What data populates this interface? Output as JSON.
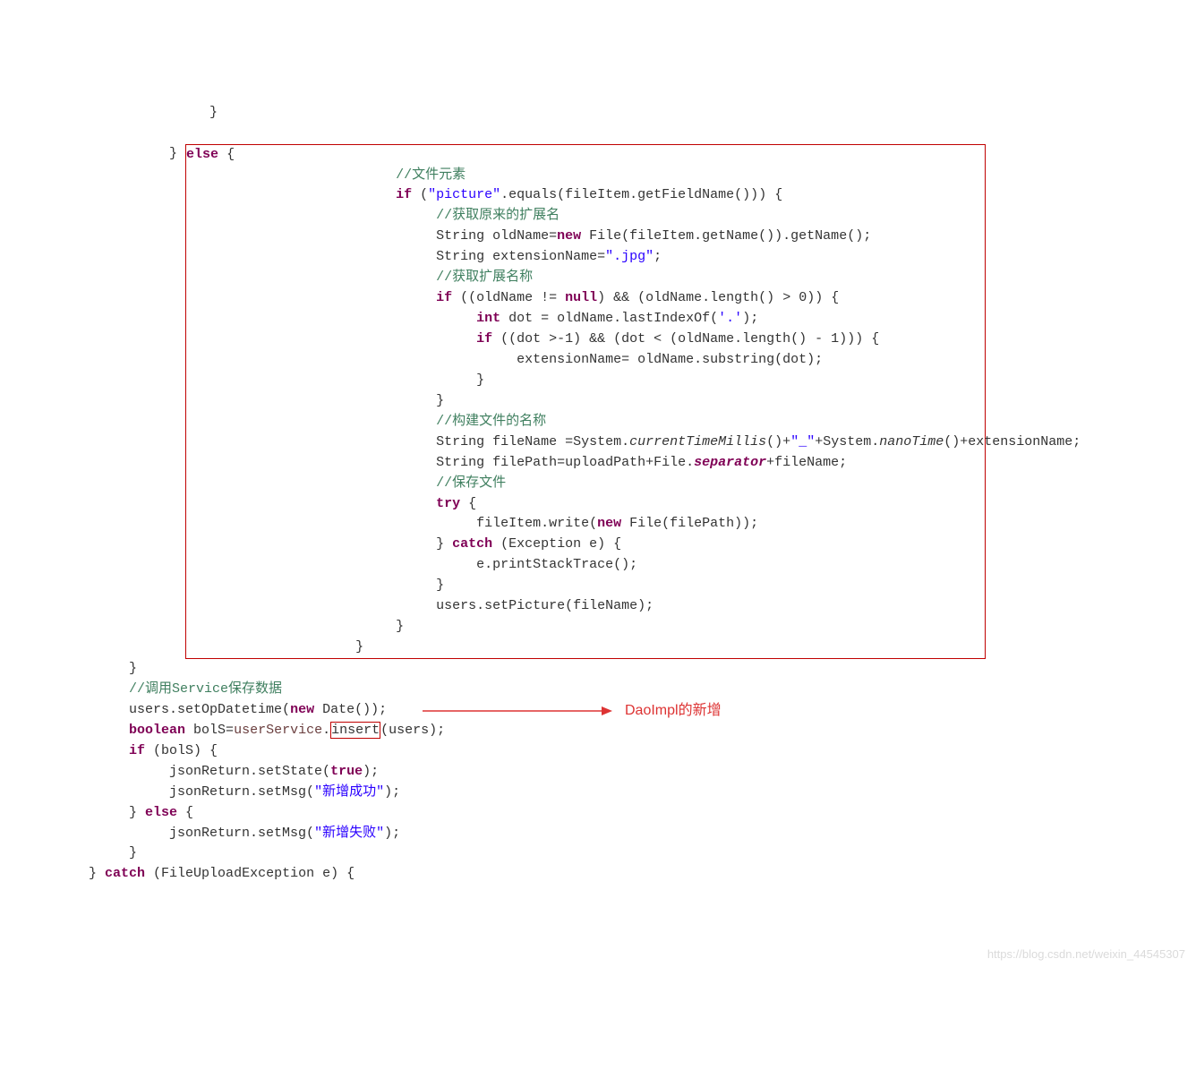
{
  "code": {
    "l1": "                          }",
    "l2": "",
    "l3": "                     } ",
    "l3k": "else",
    "l3b": " {",
    "l4": "                          ",
    "l4c": "//文件元素",
    "l5a": "                          ",
    "l5k": "if",
    "l5b": " (",
    "l5s": "\"picture\"",
    "l5c": ".equals(fileItem.getFieldName())) {",
    "l6": "                               ",
    "l6c": "//获取原来的扩展名",
    "l7a": "                               String oldName=",
    "l7k": "new",
    "l7b": " File(fileItem.getName()).getName();",
    "l8a": "                               String extensionName=",
    "l8s": "\".jpg\"",
    "l8b": ";",
    "l9": "                               ",
    "l9c": "//获取扩展名称",
    "l10a": "                               ",
    "l10k": "if",
    "l10b": " ((oldName != ",
    "l10n": "null",
    "l10c": ") && (oldName.length() > 0)) {",
    "l11a": "                                    ",
    "l11k": "int",
    "l11b": " dot = oldName.lastIndexOf(",
    "l11s": "'.'",
    "l11c": ");",
    "l12a": "                                    ",
    "l12k": "if",
    "l12b": " ((dot >-1) && (dot < (oldName.length() - 1))) {",
    "l13": "                                         extensionName= oldName.substring(dot);",
    "l14": "                                    }",
    "l15": "                               }",
    "l16": "                               ",
    "l16c": "//构建文件的名称",
    "l17a": "                               String fileName =System.",
    "l17i": "currentTimeMillis",
    "l17b": "()+",
    "l17s": "\"_\"",
    "l17c": "+System.",
    "l17j": "nanoTime",
    "l17d": "()+extensionName;",
    "l18a": "                               String filePath=uploadPath+File.",
    "l18i": "separator",
    "l18b": "+fileName;",
    "l19": "                               ",
    "l19c": "//保存文件",
    "l20a": "                               ",
    "l20k": "try",
    "l20b": " {",
    "l21a": "                                    fileItem.write(",
    "l21k": "new",
    "l21b": " File(filePath));",
    "l22a": "                               } ",
    "l22k": "catch",
    "l22b": " (Exception e) {",
    "l23": "                                    e.printStackTrace();",
    "l24": "                               }",
    "l25": "                               users.setPicture(fileName);",
    "l26": "                          }",
    "l27": "                     }",
    "l28": "                }",
    "l29": "                ",
    "l29c": "//调用Service保存数据",
    "l30a": "                users.setOpDatetime(",
    "l30k": "new",
    "l30b": " Date());",
    "l31a": "                ",
    "l31k": "boolean",
    "l31b": " bolS=",
    "l31f": "userService",
    "l31c": ".",
    "l31m": "insert",
    "l31d": "(users);",
    "l32a": "                ",
    "l32k": "if",
    "l32b": " (bolS) {",
    "l33a": "                     jsonReturn.setState(",
    "l33k": "true",
    "l33b": ");",
    "l34a": "                     jsonReturn.setMsg(",
    "l34s": "\"新增成功\"",
    "l34b": ");",
    "l35a": "                } ",
    "l35k": "else",
    "l35b": " {",
    "l36a": "                     jsonReturn.setMsg(",
    "l36s": "\"新增失败\"",
    "l36b": ");",
    "l37": "                }",
    "l38a": "           } ",
    "l38k": "catch",
    "l38b": " (FileUploadException e) {"
  },
  "annotation_text": "DaoImpl的新增",
  "watermark": "https://blog.csdn.net/weixin_44545307"
}
